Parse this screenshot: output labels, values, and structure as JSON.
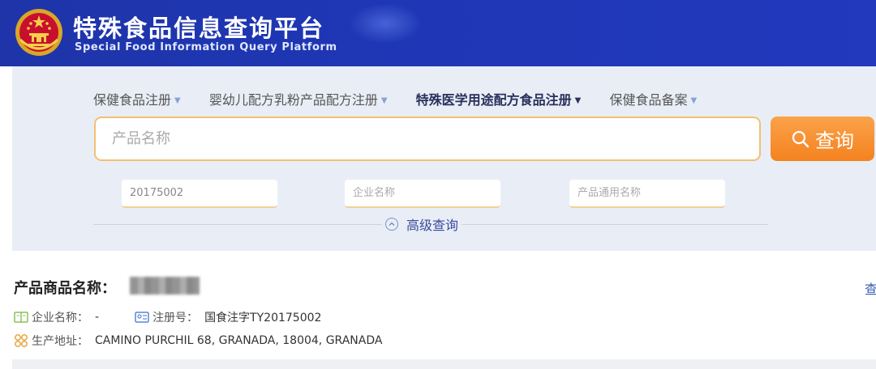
{
  "header": {
    "title_cn": "特殊食品信息查询平台",
    "title_en": "Special Food Information Query Platform",
    "emblem_icon": "national-emblem-icon"
  },
  "tabs": [
    {
      "label": "保健食品注册",
      "active": false
    },
    {
      "label": "婴幼儿配方乳粉产品配方注册",
      "active": false
    },
    {
      "label": "特殊医学用途配方食品注册",
      "active": true
    },
    {
      "label": "保健食品备案",
      "active": false
    }
  ],
  "search": {
    "placeholder": "产品名称",
    "button_label": "查询",
    "button_icon": "search-icon"
  },
  "filters": {
    "reg_number_value": "20175002",
    "company_placeholder": "企业名称",
    "generic_name_placeholder": "产品通用名称"
  },
  "advanced_label": "高级查询",
  "result": {
    "title_label": "产品商品名称：",
    "more_link": "查",
    "company_label": "企业名称：",
    "company_value": "-",
    "reg_label": "注册号：",
    "reg_value": "国食注字TY20175002",
    "address_label": "生产地址：",
    "address_value": "CAMINO PURCHIL 68, GRANADA, 18004, GRANADA"
  },
  "colors": {
    "header_blue": "#1f37b6",
    "accent_orange": "#f4821f",
    "panel_bg": "#e9eef6"
  }
}
